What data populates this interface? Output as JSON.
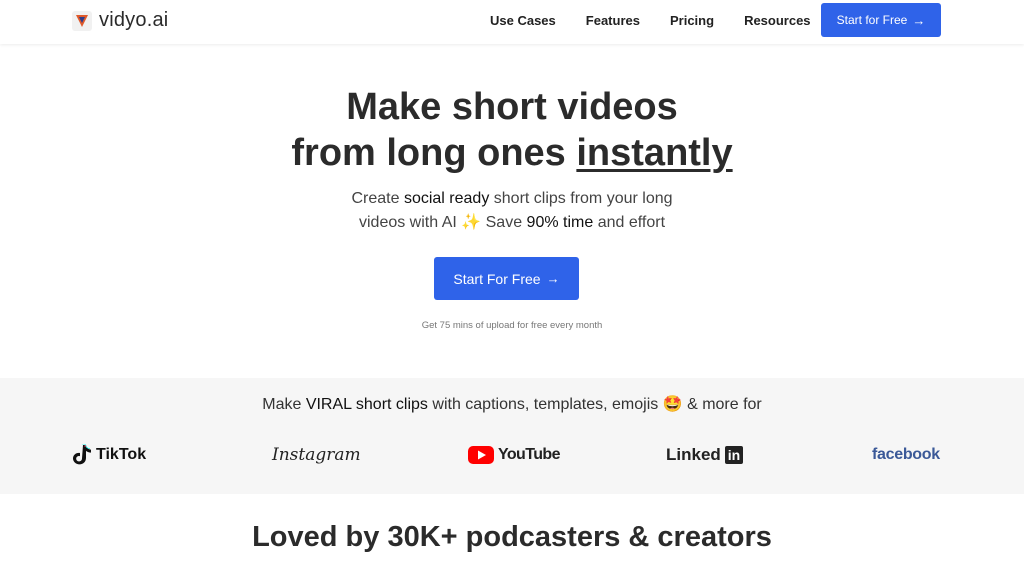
{
  "brand": {
    "name": "vidyo.ai",
    "logo_icon": "vidyo-logo-icon"
  },
  "nav": {
    "links": [
      "Use Cases",
      "Features",
      "Pricing",
      "Resources"
    ],
    "cta_label": "Start for Free",
    "cta_icon": "arrow-right-icon"
  },
  "hero": {
    "title_line1": "Make short videos",
    "title_line2_prefix": "from long ones ",
    "title_line2_emphasis": "instantly",
    "subtitle_part1": "Create ",
    "subtitle_bold1": "social ready",
    "subtitle_part2": " short clips from your long",
    "subtitle_part3": "videos with AI ✨ Save ",
    "subtitle_bold2": "90% time",
    "subtitle_part4": " and effort",
    "cta_label": "Start For Free",
    "note": "Get 75 mins of upload for free every month"
  },
  "platforms": {
    "text_part1": "Make ",
    "text_bold": "VIRAL short clips",
    "text_part2": " with captions, templates, emojis 🤩 & more for",
    "logos": {
      "tiktok": "TikTok",
      "instagram": "Instagram",
      "youtube": "YouTube",
      "linkedin_text": "Linked",
      "linkedin_box": "in",
      "facebook": "facebook"
    }
  },
  "social_proof": {
    "title": "Loved by 30K+ podcasters & creators"
  },
  "colors": {
    "primary": "#2f63e9",
    "band_bg": "#f6f6f6",
    "youtube_red": "#ff0000",
    "facebook_blue": "#3b5998"
  }
}
